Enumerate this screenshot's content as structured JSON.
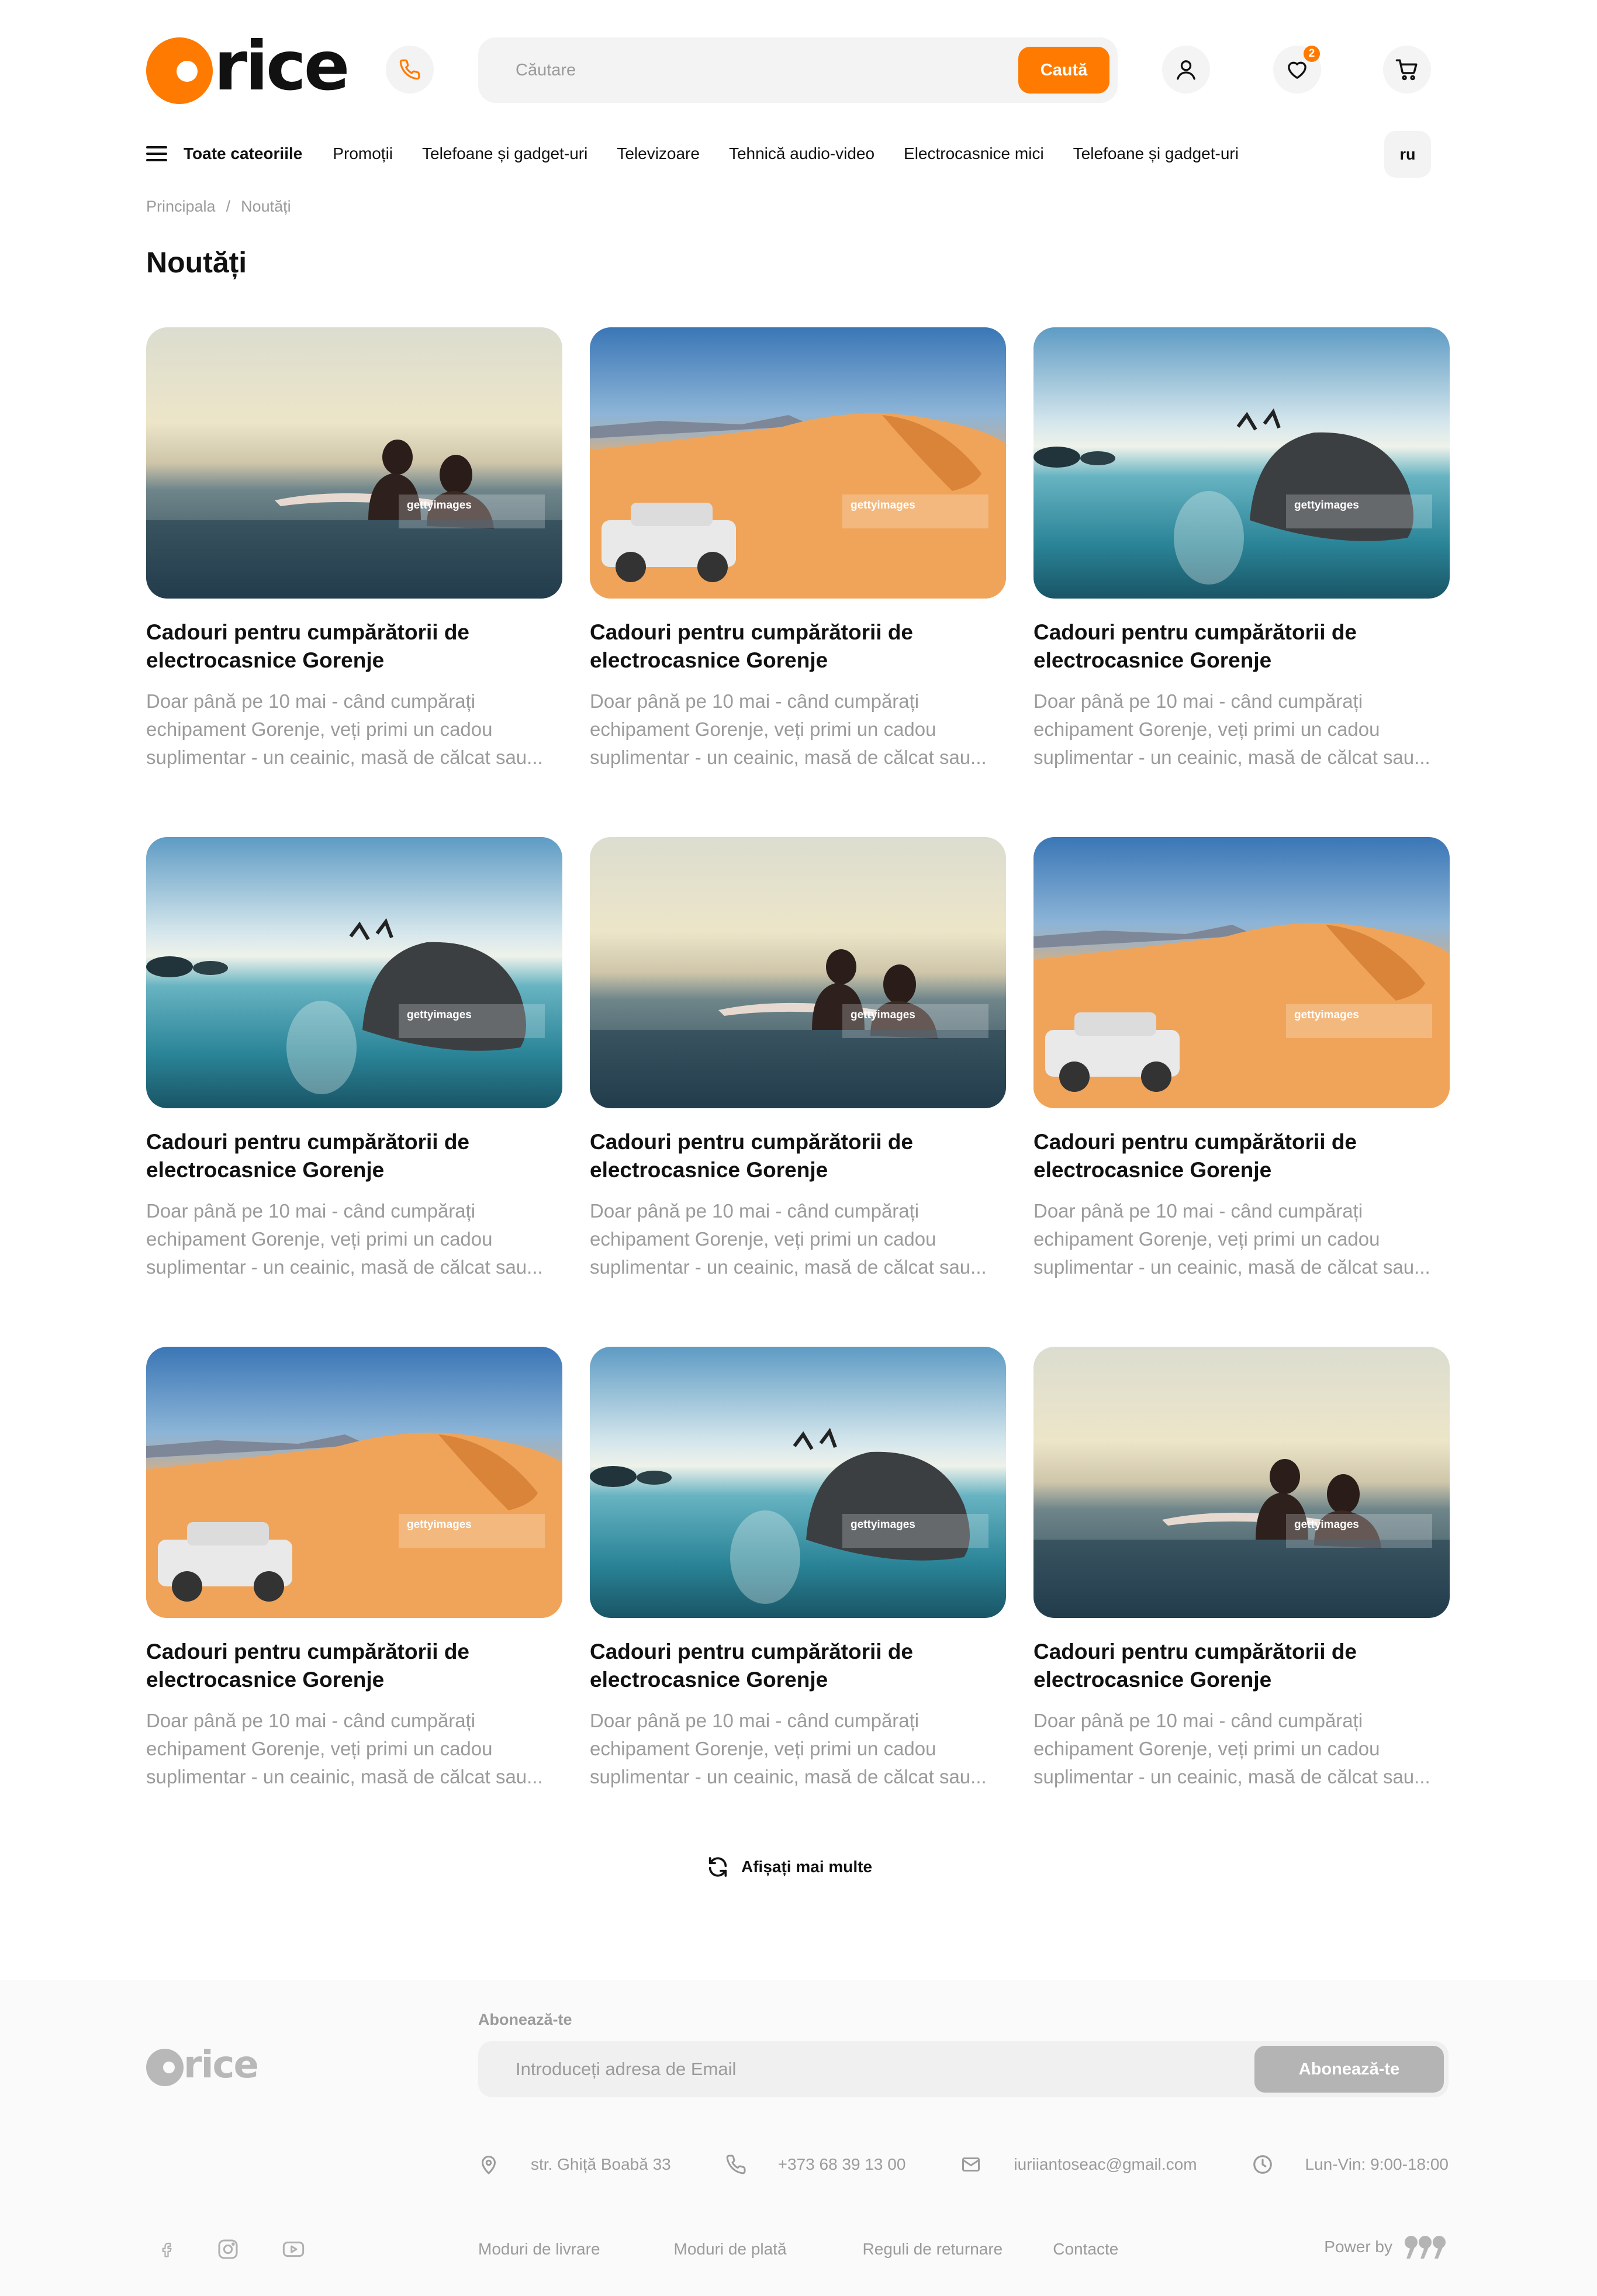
{
  "brand": {
    "logo_text": "rice",
    "accent": "#ff7a00"
  },
  "header": {
    "search_placeholder": "Căutare",
    "search_button": "Caută",
    "wishlist_count": "2"
  },
  "nav": {
    "all_categories": "Toate cateoriile",
    "items": [
      "Promoții",
      "Telefoane și gadget-uri",
      "Televizoare",
      "Tehnică audio-video",
      "Electrocasnice mici",
      "Telefoane și gadget-uri"
    ],
    "language": "ru"
  },
  "breadcrumb": {
    "home": "Principala",
    "separator": "/",
    "current": "Noutăți"
  },
  "page_title": "Noutăți",
  "cards": [
    {
      "image": "surfers",
      "title": "Cadouri pentru cumpărătorii de electrocasnice Gorenje",
      "text": "Doar până pe 10 mai - când cumpărați echipament Gorenje, veți primi un cadou suplimentar - un ceainic, masă de călcat sau..."
    },
    {
      "image": "desert-car",
      "title": "Cadouri pentru cumpărătorii de electrocasnice Gorenje",
      "text": "Doar până pe 10 mai - când cumpărați echipament Gorenje, veți primi un cadou suplimentar - un ceainic, masă de călcat sau..."
    },
    {
      "image": "rock-jump",
      "title": "Cadouri pentru cumpărătorii de electrocasnice Gorenje",
      "text": "Doar până pe 10 mai - când cumpărați echipament Gorenje, veți primi un cadou suplimentar - un ceainic, masă de călcat sau..."
    },
    {
      "image": "rock-jump",
      "title": "Cadouri pentru cumpărătorii de electrocasnice Gorenje",
      "text": "Doar până pe 10 mai - când cumpărați echipament Gorenje, veți primi un cadou suplimentar - un ceainic, masă de călcat sau..."
    },
    {
      "image": "surfers",
      "title": "Cadouri pentru cumpărătorii de electrocasnice Gorenje",
      "text": "Doar până pe 10 mai - când cumpărați echipament Gorenje, veți primi un cadou suplimentar - un ceainic, masă de călcat sau..."
    },
    {
      "image": "desert-car",
      "title": "Cadouri pentru cumpărătorii de electrocasnice Gorenje",
      "text": "Doar până pe 10 mai - când cumpărați echipament Gorenje, veți primi un cadou suplimentar - un ceainic, masă de călcat sau..."
    },
    {
      "image": "desert-car",
      "title": "Cadouri pentru cumpărătorii de electrocasnice Gorenje",
      "text": "Doar până pe 10 mai - când cumpărați echipament Gorenje, veți primi un cadou suplimentar - un ceainic, masă de călcat sau..."
    },
    {
      "image": "rock-jump",
      "title": "Cadouri pentru cumpărătorii de electrocasnice Gorenje",
      "text": "Doar până pe 10 mai - când cumpărați echipament Gorenje, veți primi un cadou suplimentar - un ceainic, masă de călcat sau..."
    },
    {
      "image": "surfers",
      "title": "Cadouri pentru cumpărătorii de electrocasnice Gorenje",
      "text": "Doar până pe 10 mai - când cumpărați echipament Gorenje, veți primi un cadou suplimentar - un ceainic, masă de călcat sau..."
    }
  ],
  "watermark": "gettyimages",
  "show_more": "Afișați mai multe",
  "footer": {
    "logo_text": "rice",
    "subscribe_label": "Abonează-te",
    "email_placeholder": "Introduceți adresa de Email",
    "subscribe_button": "Abonează-te",
    "address": "str. Ghiță Boabă 33",
    "phone": "+373 68 39 13 00",
    "email": "iuriiantoseac@gmail.com",
    "hours": "Lun-Vin: 9:00-18:00",
    "links": [
      "Moduri de livrare",
      "Moduri de plată",
      "Reguli de returnare",
      "Contacte"
    ],
    "power_by": "Power by",
    "socials": [
      "facebook-icon",
      "instagram-icon",
      "youtube-icon"
    ]
  }
}
